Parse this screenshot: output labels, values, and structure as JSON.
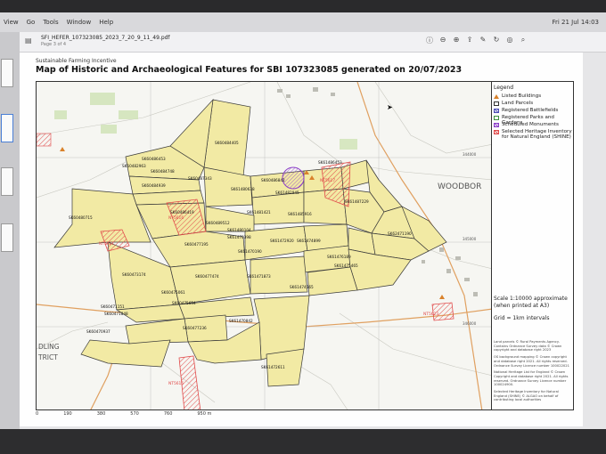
{
  "menubar": {
    "items": [
      "View",
      "Go",
      "Tools",
      "Window",
      "Help"
    ],
    "clock": "Fri 21 Jul 14:03"
  },
  "toolbar": {
    "doc_title": "SFI_HEFER_107323085_2023_7_20_9_11_49.pdf",
    "doc_page": "Page 3 of 4"
  },
  "page": {
    "programme": "Sustainable Farming Incentive",
    "title": "Map of Historic and Archaeological Features for SBI 107323085 generated on 20/07/2023"
  },
  "legend": {
    "title": "Legend",
    "items": [
      {
        "label": "Listed Buildings",
        "color": "#d9822b",
        "shape": "triangle"
      },
      {
        "label": "Land Parcels",
        "color": "#333333",
        "shape": "box"
      },
      {
        "label": "Registered Battlefields",
        "color": "#4d4fb5",
        "shape": "hatch"
      },
      {
        "label": "Registered Parks and Gardens",
        "color": "#3b8f3b",
        "shape": "box"
      },
      {
        "label": "Scheduled Monuments",
        "color": "#8b3ec8",
        "shape": "hatch"
      },
      {
        "label": "Selected Heritage Inventory for Natural England (SHINE)",
        "color": "#e14b4b",
        "shape": "hatch"
      }
    ],
    "scale": "Scale 1:10000 approximate (when printed at A3)",
    "grid": "Grid = 1km intervals",
    "credits": [
      "Land parcels © Rural Payments Agency. Contains Ordnance Survey data © Crown copyright and database right 2023",
      "OS background mapping © Crown copyright and database right 2021. All rights reserved. Ordnance Survey Licence number 100022021",
      "National Heritage List for England © Crown Copyright and database right 2021. All rights reserved. Ordnance Survey Licence number 100024900.",
      "Selected Heritage Inventory for Natural England (SHINE) © ALGAO on behalf of contributing local authorities"
    ]
  },
  "map": {
    "place_labels": [
      "WOODBOR",
      "DLING",
      "TRICT"
    ],
    "parcels": [
      "SK60484405",
      "SK60486453",
      "SK60482963",
      "SK60484748",
      "SK60484939",
      "SK60487343",
      "SK61480638",
      "SK60486842",
      "SK61486453",
      "SK61487229",
      "SK60480715",
      "SK60486419",
      "SK61481421",
      "SK61482945",
      "SK61485916",
      "SK60489512",
      "SK61480104",
      "SK61470398",
      "SK60477195",
      "SK61472920",
      "SK61474899",
      "SK62471190",
      "SK61470190",
      "SK61476189",
      "SK61475465",
      "SK60473174",
      "SK60477474",
      "SK61471873",
      "SK61474565",
      "SK60475061",
      "SK60475654",
      "SK60471151",
      "SK60471848",
      "SK61470842",
      "SK60470937",
      "SK60477236",
      "SK61472611"
    ],
    "shine_labels": [
      "NT5616",
      "NT5621",
      "NT5617",
      "NT5615",
      "NT5623"
    ],
    "grid_labels": [
      "344000",
      "345000",
      "346000"
    ],
    "scale_ticks": [
      "0",
      "190",
      "380",
      "570",
      "760",
      "950 m"
    ]
  },
  "colors": {
    "parcel_fill": "#f2eaa4",
    "parcel_stroke": "#3a3a3a",
    "shine": "#e14b4b",
    "monument": "#8b3ec8",
    "page": "#fefefe"
  }
}
